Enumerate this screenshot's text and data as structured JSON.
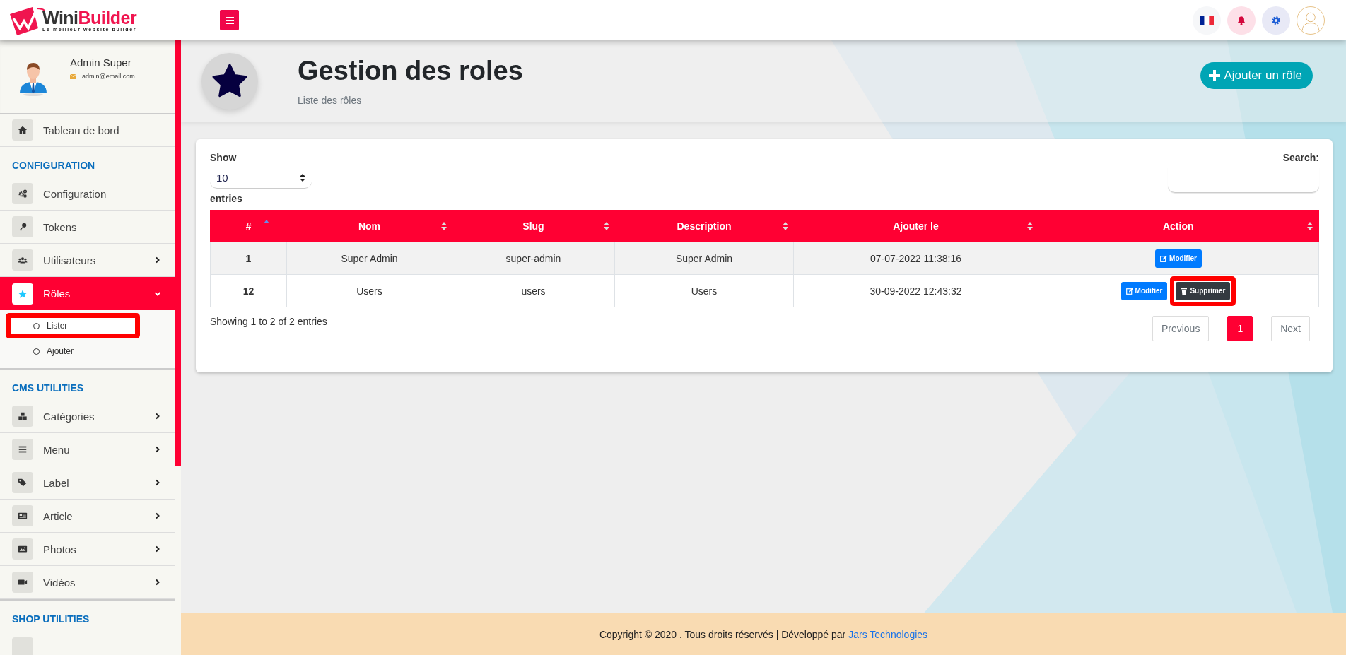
{
  "brand": {
    "name_first": "Wini",
    "name_second": "Builder",
    "tagline": "Le meilleur website builder"
  },
  "user": {
    "name": "Admin Super",
    "email": "admin@email.com"
  },
  "sidebar": {
    "items": [
      {
        "kind": "link",
        "label": "Tableau de bord",
        "selected": false
      },
      {
        "kind": "heading",
        "label": "CONFIGURATION"
      },
      {
        "kind": "link",
        "label": "Configuration",
        "selected": false
      },
      {
        "kind": "link",
        "label": "Tokens",
        "selected": false
      },
      {
        "kind": "link",
        "label": "Utilisateurs",
        "selected": false,
        "expanded": false
      },
      {
        "kind": "link",
        "label": "Rôles",
        "selected": true,
        "expanded": true,
        "children": [
          {
            "label": "Lister",
            "highlighted": true
          },
          {
            "label": "Ajouter",
            "highlighted": false
          }
        ]
      },
      {
        "kind": "heading",
        "label": "CMS UTILITIES"
      },
      {
        "kind": "link",
        "label": "Catégories",
        "selected": false,
        "expanded": false
      },
      {
        "kind": "link",
        "label": "Menu",
        "selected": false,
        "expanded": false
      },
      {
        "kind": "link",
        "label": "Label",
        "selected": false,
        "expanded": false
      },
      {
        "kind": "link",
        "label": "Article",
        "selected": false,
        "expanded": false
      },
      {
        "kind": "link",
        "label": "Photos",
        "selected": false,
        "expanded": false
      },
      {
        "kind": "link",
        "label": "Vidéos",
        "selected": false,
        "expanded": false
      },
      {
        "kind": "heading",
        "label": "SHOP UTILITIES"
      },
      {
        "kind": "partial"
      }
    ]
  },
  "page_header": {
    "title": "Gestion des roles",
    "subtitle": "Liste des rôles",
    "add_button": "Ajouter un rôle"
  },
  "table_controls": {
    "show_label": "Show",
    "page_size": "10",
    "entries_label": "entries",
    "search_label": "Search:"
  },
  "table": {
    "columns": [
      {
        "label": "#",
        "sorted": true
      },
      {
        "label": "Nom",
        "sorted": false
      },
      {
        "label": "Slug",
        "sorted": false
      },
      {
        "label": "Description",
        "sorted": false
      },
      {
        "label": "Ajouter le",
        "sorted": false
      },
      {
        "label": "Action",
        "sorted": false
      }
    ],
    "rows": [
      {
        "cells": [
          "1",
          "Super Admin",
          "super-admin",
          "Super Admin",
          "07-07-2022 11:38:16"
        ],
        "actions": [
          {
            "kind": "edit",
            "label": "Modifier",
            "highlighted": false
          }
        ]
      },
      {
        "cells": [
          "12",
          "Users",
          "users",
          "Users",
          "30-09-2022 12:43:32"
        ],
        "actions": [
          {
            "kind": "edit",
            "label": "Modifier",
            "highlighted": false
          },
          {
            "kind": "delete",
            "label": "Supprimer",
            "highlighted": true
          }
        ]
      }
    ]
  },
  "info": "Showing 1 to 2 of 2 entries",
  "pagination": [
    {
      "label": "Previous",
      "selected": false
    },
    {
      "label": "1",
      "selected": true
    },
    {
      "label": "Next",
      "selected": false
    }
  ],
  "footer": {
    "text": "Copyright © 2020 . Tous droits réservés | Développé par",
    "link": "Jars Technologies"
  }
}
